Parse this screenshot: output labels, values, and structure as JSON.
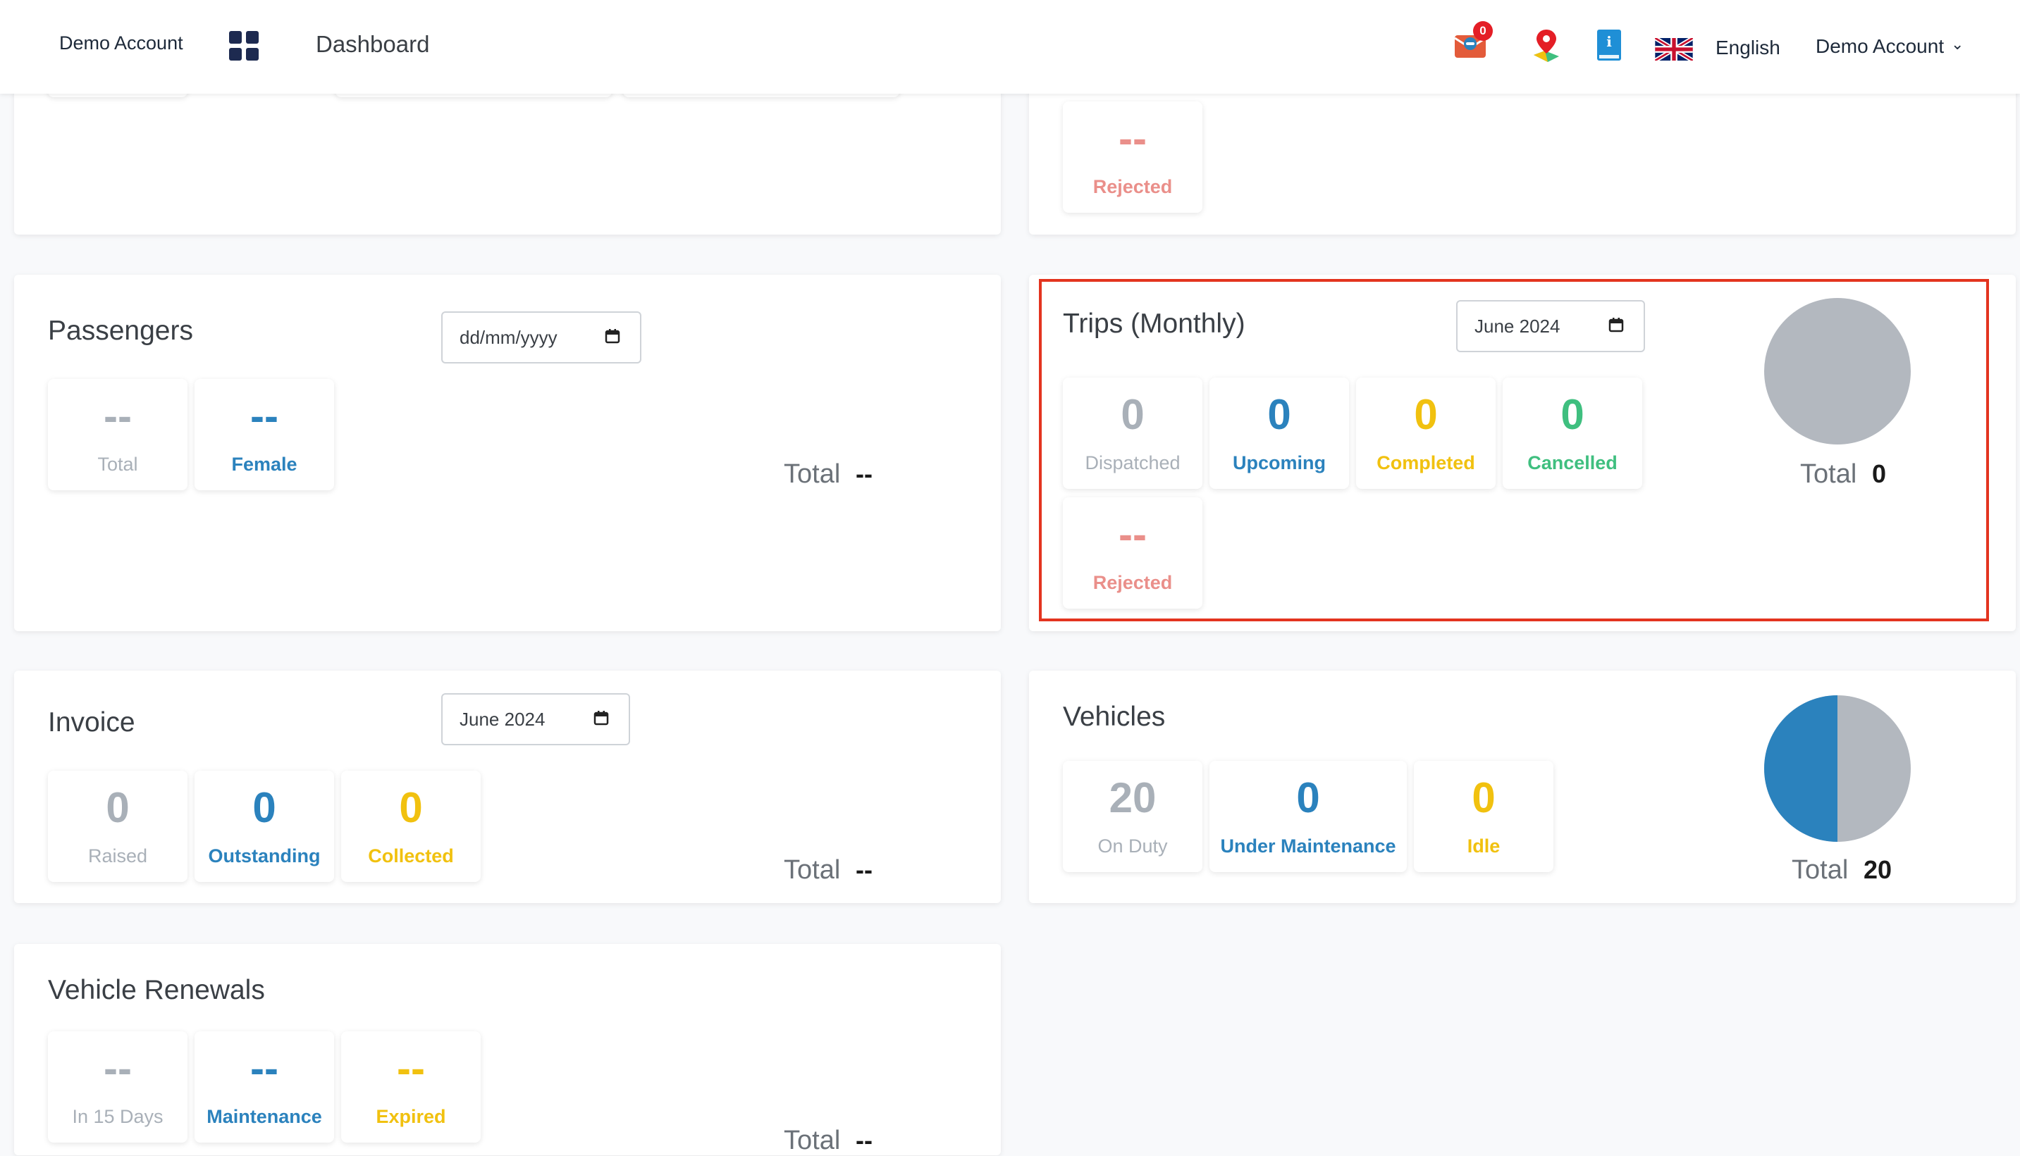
{
  "topbar": {
    "account_left": "Demo Account",
    "title": "Dashboard",
    "mail_badge": "0",
    "language": "English",
    "account_right": "Demo Account",
    "chevron": "⌄"
  },
  "partial_top_right": {
    "rejected": {
      "value": "--",
      "label": "Rejected"
    }
  },
  "passengers": {
    "title": "Passengers",
    "date_placeholder": "dd/mm/yyyy",
    "cards": [
      {
        "value": "--",
        "label": "Total"
      },
      {
        "value": "--",
        "label": "Female"
      }
    ],
    "total_label": "Total",
    "total_value": "--"
  },
  "trips": {
    "title": "Trips (Monthly)",
    "date_value": "June 2024",
    "cards": [
      {
        "value": "0",
        "label": "Dispatched"
      },
      {
        "value": "0",
        "label": "Upcoming"
      },
      {
        "value": "0",
        "label": "Completed"
      },
      {
        "value": "0",
        "label": "Cancelled"
      },
      {
        "value": "--",
        "label": "Rejected"
      }
    ],
    "total_label": "Total",
    "total_value": "0"
  },
  "invoice": {
    "title": "Invoice",
    "date_value": "June 2024",
    "cards": [
      {
        "value": "0",
        "label": "Raised"
      },
      {
        "value": "0",
        "label": "Outstanding"
      },
      {
        "value": "0",
        "label": "Collected"
      }
    ],
    "total_label": "Total",
    "total_value": "--"
  },
  "vehicles": {
    "title": "Vehicles",
    "cards": [
      {
        "value": "20",
        "label": "On Duty"
      },
      {
        "value": "0",
        "label": "Under Maintenance"
      },
      {
        "value": "0",
        "label": "Idle"
      }
    ],
    "total_label": "Total",
    "total_value": "20",
    "pie_colors": {
      "on_duty": "#b3b8bf",
      "under_maintenance": "#2b82bd"
    }
  },
  "renewals": {
    "title": "Vehicle Renewals",
    "cards": [
      {
        "value": "--",
        "label": "In 15 Days"
      },
      {
        "value": "--",
        "label": "Maintenance"
      },
      {
        "value": "--",
        "label": "Expired"
      }
    ],
    "total_label": "Total",
    "total_value": "--"
  },
  "colors": {
    "highlight": "#e3341f",
    "blue": "#2b82bd",
    "yellow": "#f1c10f",
    "green": "#3fbf7f",
    "red": "#ea8f8a",
    "gray": "#a9b0b8"
  }
}
